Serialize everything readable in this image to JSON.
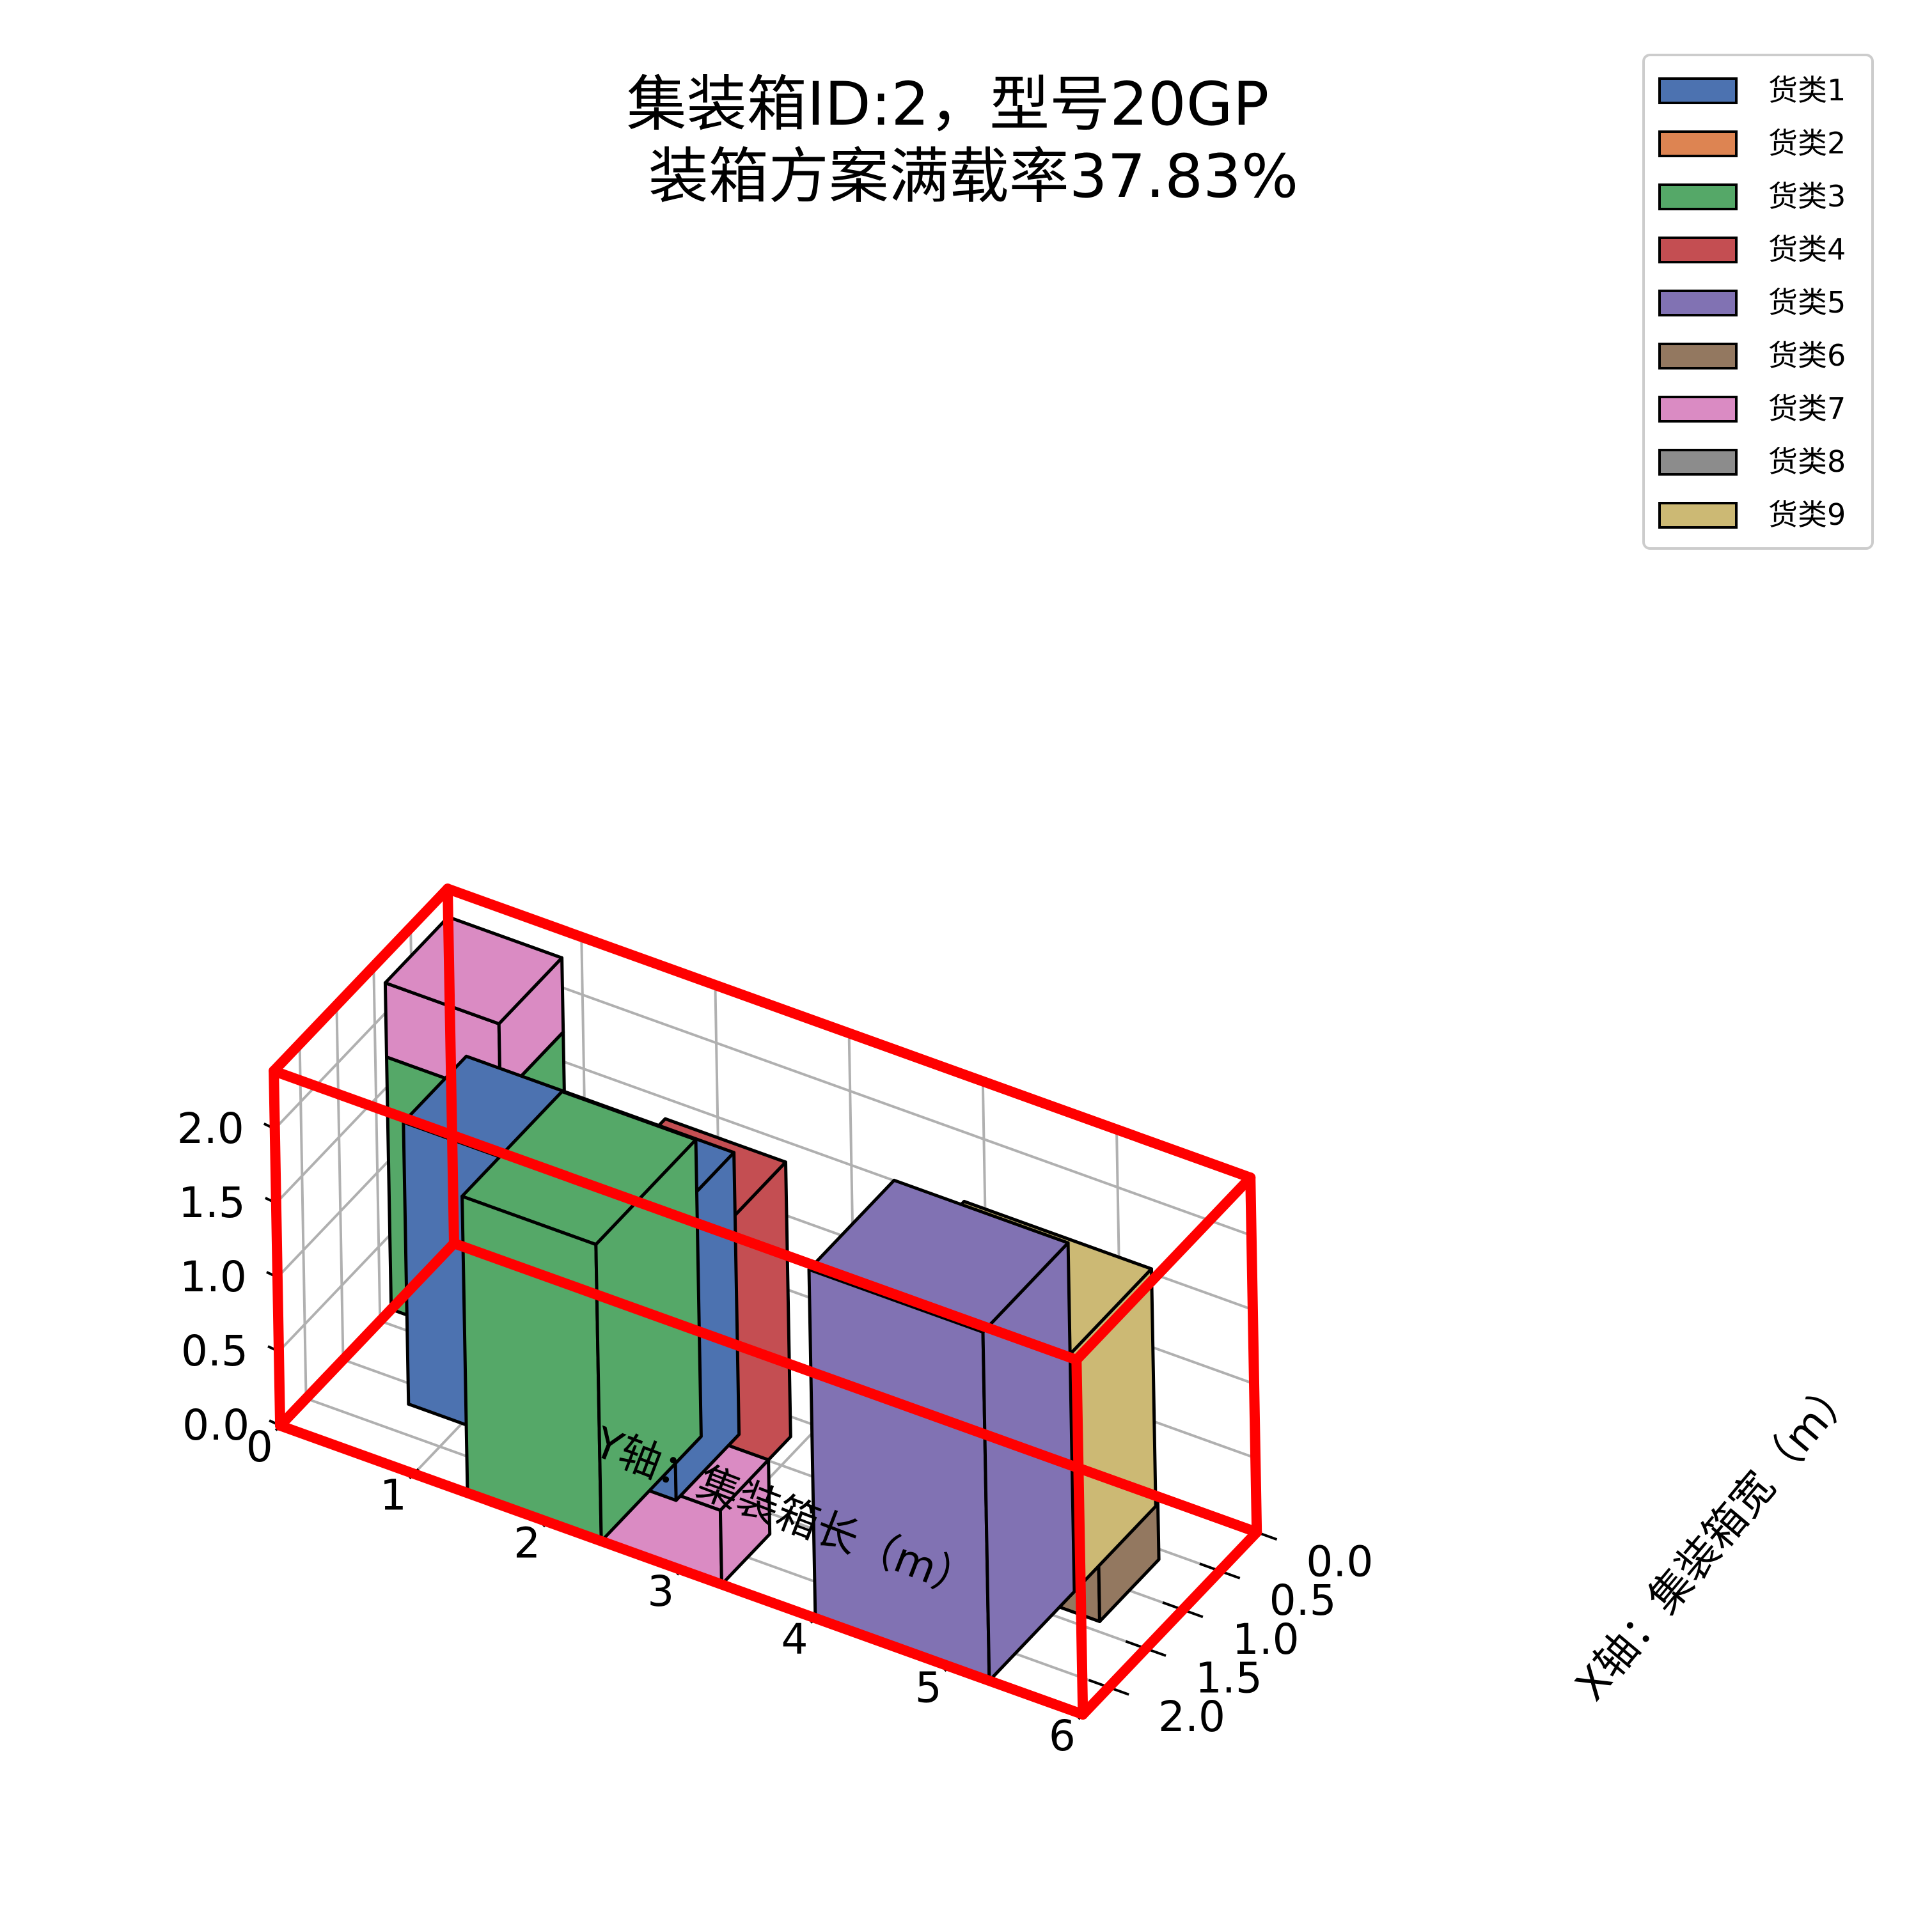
{
  "chart_data": {
    "type": "3d-bar",
    "title_lines": [
      "集装箱ID:2，型号20GP",
      "装箱方案满载率37.83%"
    ],
    "xlabel": "X轴：集装箱宽（m）",
    "ylabel": "Y轴：集装箱长（m）",
    "zlabel": "",
    "xlim": [
      0,
      2.35
    ],
    "ylim": [
      0,
      6
    ],
    "zlim": [
      0,
      2.39
    ],
    "x_ticks": [
      "0.0",
      "0.5",
      "1.0",
      "1.5",
      "2.0"
    ],
    "y_ticks": [
      "0",
      "1",
      "2",
      "3",
      "4",
      "5",
      "6"
    ],
    "z_ticks": [
      "0.0",
      "0.5",
      "1.0",
      "1.5",
      "2.0"
    ],
    "grid": true,
    "legend_position": "top-right",
    "container_outline_color": "#ff0000",
    "legend": [
      {
        "label": "货类1",
        "color": "#4c72b0"
      },
      {
        "label": "货类2",
        "color": "#dd8452"
      },
      {
        "label": "货类3",
        "color": "#55a868"
      },
      {
        "label": "货类4",
        "color": "#c44e52"
      },
      {
        "label": "货类5",
        "color": "#8172b3"
      },
      {
        "label": "货类6",
        "color": "#937860"
      },
      {
        "label": "货类7",
        "color": "#da8bc3"
      },
      {
        "label": "货类8",
        "color": "#8c8c8c"
      },
      {
        "label": "货类9",
        "color": "#ccb974"
      }
    ],
    "boxes": [
      {
        "cargo": "货类3",
        "x": [
          0,
          0.85
        ],
        "y": [
          0,
          0.85
        ],
        "z": [
          0,
          1.7
        ]
      },
      {
        "cargo": "货类7",
        "x": [
          0,
          0.85
        ],
        "y": [
          0,
          0.85
        ],
        "z": [
          1.7,
          2.2
        ]
      },
      {
        "cargo": "货类1",
        "x": [
          0.85,
          1.7
        ],
        "y": [
          0.6,
          2.6
        ],
        "z": [
          0,
          1.9
        ]
      },
      {
        "cargo": "货类7",
        "x": [
          1.7,
          2.35
        ],
        "y": [
          2.4,
          3.3
        ],
        "z": [
          0,
          0.5
        ]
      },
      {
        "cargo": "货类3",
        "x": [
          1.0,
          2.35
        ],
        "y": [
          1.4,
          2.4
        ],
        "z": [
          0,
          2.0
        ]
      },
      {
        "cargo": "货类4",
        "x": [
          1.4,
          2.35
        ],
        "y": [
          2.4,
          3.3
        ],
        "z": [
          0.5,
          2.35
        ]
      },
      {
        "cargo": "货类6",
        "x": [
          0.6,
          1.4
        ],
        "y": [
          5.1,
          5.6
        ],
        "z": [
          0,
          0.4
        ]
      },
      {
        "cargo": "货类9",
        "x": [
          0.1,
          1.25
        ],
        "y": [
          3.9,
          5.3
        ],
        "z": [
          0,
          1.6
        ]
      },
      {
        "cargo": "货类5",
        "x": [
          1.2,
          2.35
        ],
        "y": [
          4.0,
          5.3
        ],
        "z": [
          0,
          2.35
        ]
      }
    ]
  }
}
